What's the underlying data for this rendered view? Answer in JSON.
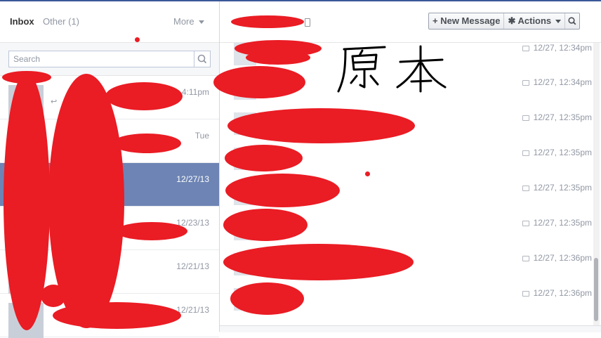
{
  "left_panel": {
    "tabs": {
      "inbox": "Inbox",
      "other": "Other (1)",
      "more": "More"
    },
    "search": {
      "placeholder": "Search"
    },
    "threads": [
      {
        "time": "4:11pm",
        "selected": false
      },
      {
        "time": "Tue",
        "selected": false
      },
      {
        "time": "12/27/13",
        "selected": true
      },
      {
        "time": "12/23/13",
        "selected": false
      },
      {
        "time": "12/21/13",
        "selected": false
      },
      {
        "time": "12/21/13",
        "selected": false
      }
    ]
  },
  "conversation": {
    "actions": {
      "new_message": "+ New Message",
      "actions": "✱ Actions"
    },
    "messages": [
      {
        "timestamp": "12/27, 12:34pm"
      },
      {
        "timestamp": "12/27, 12:34pm"
      },
      {
        "timestamp": "12/27, 12:35pm"
      },
      {
        "timestamp": "12/27, 12:35pm"
      },
      {
        "timestamp": "12/27, 12:35pm"
      },
      {
        "timestamp": "12/27, 12:35pm"
      },
      {
        "timestamp": "12/27, 12:36pm"
      },
      {
        "timestamp": "12/27, 12:36pm"
      }
    ]
  },
  "annotation": {
    "handwritten_text": "原本",
    "redaction_color": "#ea1c24"
  },
  "colors": {
    "brand": "#3b5998",
    "selected_row": "#6d84b4"
  }
}
